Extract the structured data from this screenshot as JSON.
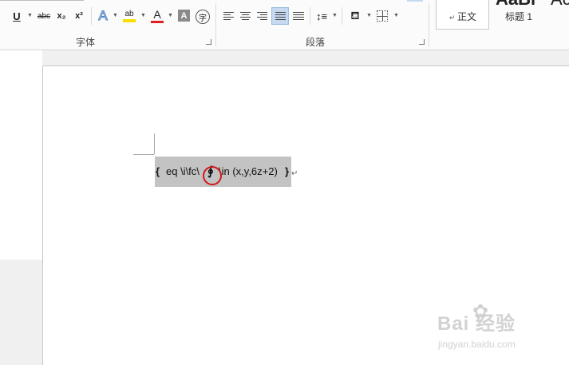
{
  "font_group": {
    "label": "字体",
    "underline": "U",
    "strike": "abc",
    "subscript": "x₂",
    "superscript": "x²",
    "text_effect": "A",
    "highlight": "ab",
    "font_color": "A",
    "char_shading": "A",
    "enclose": "字"
  },
  "paragraph_group": {
    "label": "段落"
  },
  "styles": {
    "normal_label": "正文",
    "h1_label": "标题 1",
    "preview_big": "AaBl",
    "preview_cut": "Ac"
  },
  "document": {
    "field_open": "{",
    "field_code": "eq \\i\\fc\\",
    "field_symbol": "∮",
    "field_rest": "\\in (x,y,6z+2)",
    "field_close": "}",
    "para_mark": "↵"
  },
  "watermark": {
    "main": "Bai  经验",
    "url": "jingyan.baidu.com"
  },
  "colors": {
    "highlight": "#f5e000",
    "font_color": "#e02020",
    "selection": "#c3c3c3",
    "circle": "#d01818"
  }
}
